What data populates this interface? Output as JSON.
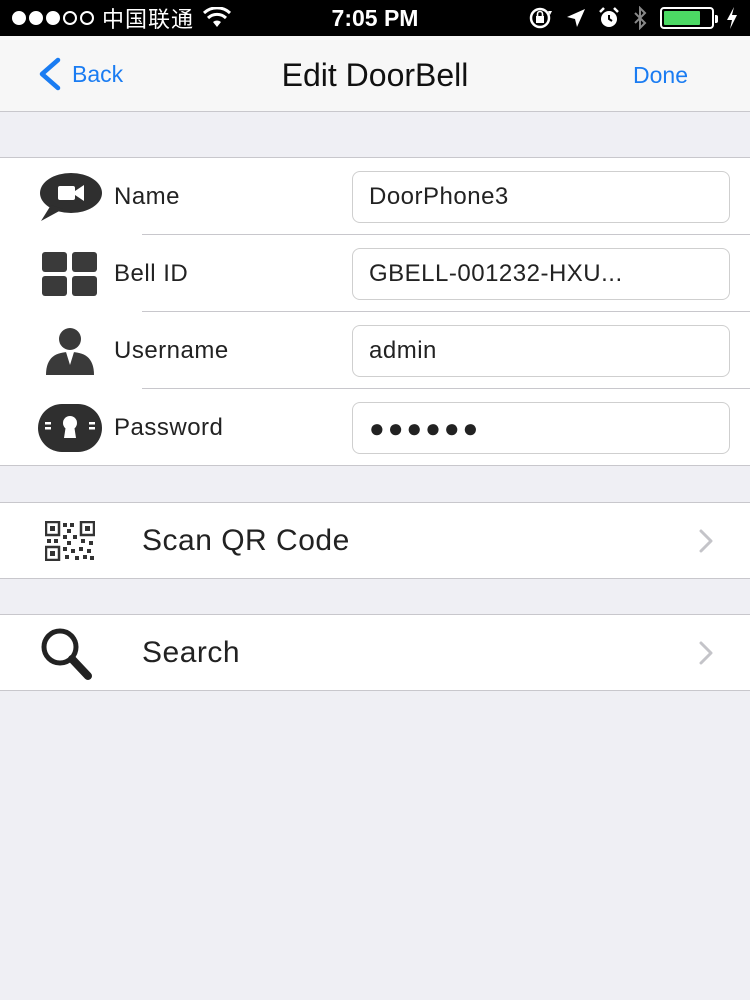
{
  "status_bar": {
    "carrier": "中国联通",
    "time": "7:05 PM"
  },
  "nav": {
    "back_label": "Back",
    "title": "Edit DoorBell",
    "done_label": "Done"
  },
  "form": {
    "name": {
      "label": "Name",
      "value": "DoorPhone3",
      "icon": "video-chat-icon"
    },
    "bell_id": {
      "label": "Bell ID",
      "value": "GBELL-001232-HXU...",
      "icon": "grid-icon"
    },
    "username": {
      "label": "Username",
      "value": "admin",
      "icon": "user-icon"
    },
    "password": {
      "label": "Password",
      "value": "●●●●●●",
      "icon": "keyhole-icon"
    }
  },
  "actions": {
    "scan_qr": {
      "label": "Scan QR Code",
      "icon": "qr-code-icon"
    },
    "search": {
      "label": "Search",
      "icon": "magnifier-icon"
    }
  },
  "colors": {
    "accent": "#1a7cf2",
    "battery": "#4cd964",
    "background": "#efeff4"
  }
}
